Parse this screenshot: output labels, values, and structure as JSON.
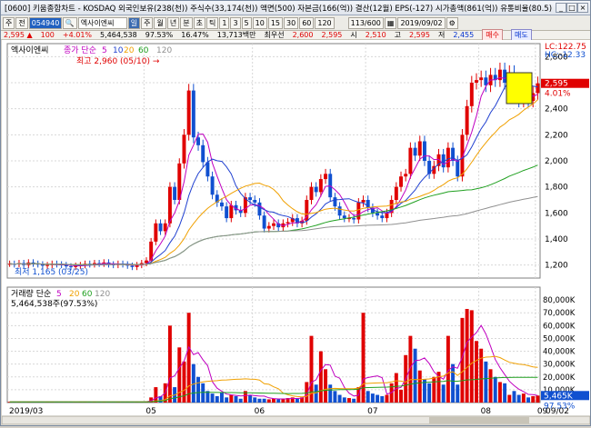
{
  "window": {
    "title": "[0600] 키움종합차트 - KOSDAQ 외국인보유(238(천)) 주식수(33,174(천)) 액면(500) 자본금(166(억)) 결산(12월) EPS(-127) 시가총액(861(억)) 유통비율(80.5)"
  },
  "toolbar": {
    "buttons": [
      "주",
      "전"
    ],
    "code": "054940",
    "name": "엑사이엔씨",
    "period_buttons": [
      "일",
      "주",
      "월",
      "년",
      "분",
      "초",
      "틱"
    ],
    "interval_buttons": [
      "1",
      "3",
      "5",
      "10",
      "15",
      "30",
      "60",
      "120"
    ],
    "count": "113/600",
    "date": "2019/09/02"
  },
  "infobar": {
    "price": "2,595 ▲",
    "change": "100",
    "rate": "+4.01%",
    "volume": "5,464,538",
    "vol_rate": "97.53%",
    "ratio": "16.47%",
    "amount": "13,713백만",
    "prev_label": "최우선",
    "ask": "2,600",
    "ask2": "2,595",
    "open_label": "시",
    "open": "2,510",
    "high_label": "고",
    "high": "2,595",
    "low_label": "저",
    "low": "2,455",
    "buy": "매수",
    "sell": "매도"
  },
  "price_panel": {
    "stock_label": "엑사이엔씨",
    "ma_label": "종가 단순",
    "ma_periods": [
      "5",
      "10",
      "20",
      "60",
      "120"
    ],
    "high_annotation": "최고 2,960 (05/10) →",
    "low_annotation": "최저 1,165 (03/25)",
    "lc": "LC:122.75",
    "hc": "HC:-12.33",
    "current_price": "2,595",
    "current_rate": "4.01%"
  },
  "volume_panel": {
    "label": "거래량 단순",
    "ma_periods": [
      "5",
      "20",
      "60",
      "120"
    ],
    "value": "5,464,538주(97.53%)",
    "current_value": "5,465K",
    "current_rate": "97.53%"
  },
  "x_axis": {
    "labels": [
      "2019/03",
      "05",
      "06",
      "07",
      "08",
      "09"
    ],
    "right_label": "09/02"
  },
  "colors": {
    "up": "#e00000",
    "down": "#1050d0",
    "ma5": "#c000c0",
    "ma10": "#2040d0",
    "ma20": "#f0a000",
    "ma60": "#20a020",
    "ma120": "#909090"
  },
  "chart_data": [
    {
      "type": "candlestick",
      "ylim": [
        1100,
        2900
      ],
      "yticks": [
        "2,800",
        "2,600",
        "2,400",
        "2,200",
        "2,000",
        "1,800",
        "1,600",
        "1,400",
        "1,200"
      ],
      "ytick_values": [
        2800,
        2600,
        2400,
        2200,
        2000,
        1800,
        1600,
        1400,
        1200
      ],
      "series": [
        "5",
        "10",
        "20",
        "60",
        "120"
      ],
      "closes": [
        1210,
        1205,
        1215,
        1200,
        1220,
        1210,
        1205,
        1195,
        1200,
        1210,
        1205,
        1200,
        1190,
        1185,
        1195,
        1200,
        1210,
        1205,
        1215,
        1210,
        1220,
        1205,
        1200,
        1210,
        1205,
        1195,
        1185,
        1200,
        1215,
        1235,
        1380,
        1520,
        1460,
        1520,
        1800,
        1700,
        1980,
        2200,
        2540,
        2180,
        2120,
        1990,
        1880,
        1740,
        1680,
        1650,
        1560,
        1660,
        1620,
        1600,
        1720,
        1700,
        1680,
        1580,
        1480,
        1500,
        1520,
        1490,
        1520,
        1530,
        1560,
        1520,
        1540,
        1700,
        1800,
        1760,
        1860,
        1900,
        1720,
        1650,
        1580,
        1560,
        1560,
        1550,
        1680,
        1700,
        1640,
        1600,
        1580,
        1560,
        1600,
        1700,
        1800,
        1880,
        1900,
        2100,
        2040,
        2150,
        2000,
        1900,
        1960,
        2050,
        1950,
        2100,
        2000,
        1880,
        2200,
        2420,
        2600,
        2620,
        2640,
        2580,
        2660,
        2620,
        2700,
        2600,
        2680,
        2520,
        2460,
        2520,
        2460,
        2520,
        2595
      ]
    },
    {
      "type": "bar",
      "ylim": [
        0,
        90000
      ],
      "yticks": [
        "80,000K",
        "70,000K",
        "60,000K",
        "50,000K",
        "40,000K",
        "30,000K",
        "20,000K",
        "10,000K"
      ],
      "ytick_values": [
        80000,
        70000,
        60000,
        50000,
        40000,
        30000,
        20000,
        10000
      ],
      "values": [
        600,
        500,
        700,
        400,
        500,
        600,
        500,
        400,
        500,
        600,
        500,
        400,
        500,
        400,
        500,
        600,
        500,
        400,
        500,
        600,
        500,
        400,
        500,
        600,
        500,
        400,
        500,
        600,
        700,
        900,
        4000,
        12000,
        5000,
        15000,
        60000,
        12000,
        43000,
        32000,
        70000,
        30000,
        20000,
        15000,
        9000,
        7000,
        5000,
        8000,
        4000,
        6000,
        5000,
        3000,
        9000,
        6000,
        4000,
        3000,
        3000,
        2500,
        3000,
        2500,
        3000,
        3500,
        4000,
        3000,
        4000,
        16000,
        52000,
        14000,
        40000,
        26000,
        14000,
        9000,
        6000,
        4000,
        3500,
        3000,
        12000,
        70000,
        9000,
        7000,
        6000,
        5000,
        6000,
        15000,
        23000,
        10000,
        37000,
        52000,
        42000,
        25000,
        18000,
        15000,
        20000,
        24000,
        14000,
        52000,
        30000,
        14000,
        66000,
        73000,
        72000,
        48000,
        42000,
        32000,
        26000,
        20000,
        16000,
        15000,
        6000,
        9000,
        6000,
        7000,
        4000,
        5000,
        5465
      ]
    }
  ]
}
